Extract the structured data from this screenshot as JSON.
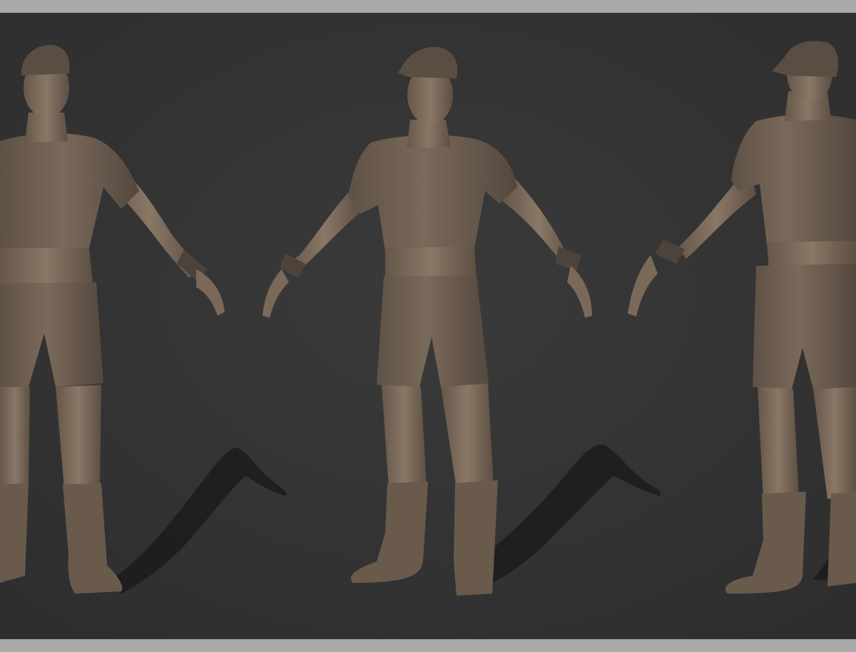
{
  "scene": {
    "background_color": "#343434",
    "border_color": "#a9a9a9",
    "model_color": "#6f6053",
    "model_shade_color": "#564a40",
    "skin_color": "#7b6a5c",
    "shadow_color": "#1c1c1c",
    "views": [
      {
        "name": "front-view",
        "icon": "figure-front"
      },
      {
        "name": "three-quarter-view",
        "icon": "figure-three-quarter"
      },
      {
        "name": "back-view",
        "icon": "figure-back"
      }
    ]
  }
}
